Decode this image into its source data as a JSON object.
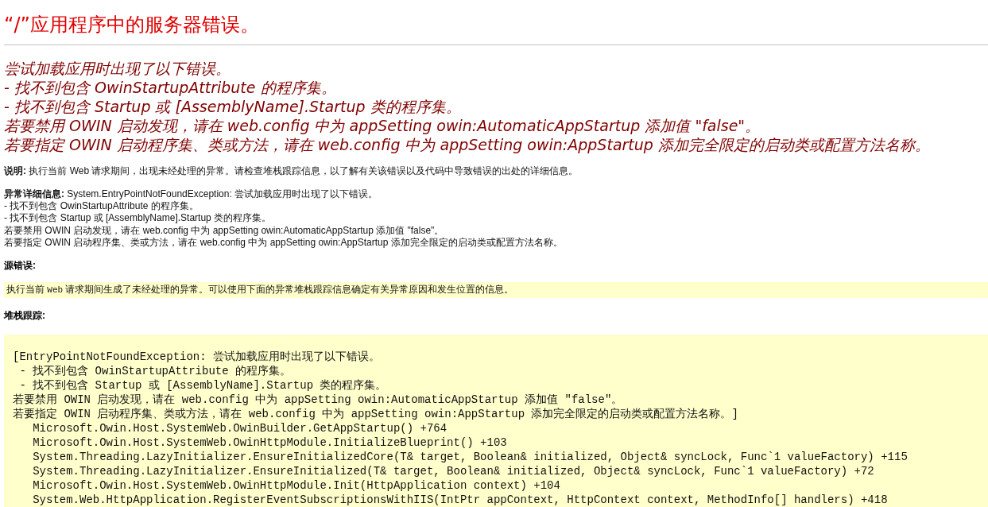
{
  "title": "“/”应用程序中的服务器错误。",
  "error_message": {
    "lines": [
      "尝试加载应用时出现了以下错误。",
      "- 找不到包含 OwinStartupAttribute 的程序集。",
      "- 找不到包含 Startup 或 [AssemblyName].Startup 类的程序集。",
      "若要禁用 OWIN 启动发现，请在 web.config 中为 appSetting owin:AutomaticAppStartup 添加值 \"false\"。",
      "若要指定 OWIN 启动程序集、类或方法，请在 web.config 中为 appSetting owin:AppStartup 添加完全限定的启动类或配置方法名称。"
    ]
  },
  "description": {
    "text": "**说明:** 执行当前 Web 请求期间，出现未经处理的异常。请检查堆栈跟踪信息，以了解有关该错误以及代码中导致错误的出处的详细信息。"
  },
  "exception_details": {
    "lines": [
      "**异常详细信息:** System.EntryPointNotFoundException: 尝试加载应用时出现了以下错误。",
      "- 找不到包含 OwinStartupAttribute 的程序集。",
      "- 找不到包含 Startup 或 [AssemblyName].Startup 类的程序集。",
      "若要禁用 OWIN 启动发现，请在 web.config 中为 appSetting owin:AutomaticAppStartup 添加值 \"false\"。",
      "若要指定 OWIN 启动程序集、类或方法，请在 web.config 中为 appSetting owin:AppStartup 添加完全限定的启动类或配置方法名称。"
    ]
  },
  "source_error": {
    "heading": "源错误:",
    "parts": [
      {
        "kind": "text",
        "text": "执行当前 "
      },
      {
        "kind": "code",
        "text": "Web"
      },
      {
        "kind": "text",
        "text": " 请求期间生成了未经处理的异常。可以使用下面的异常堆栈跟踪信息确定有关异常原因和发生位置的信息。"
      }
    ]
  },
  "stack_trace": {
    "heading": "堆栈跟踪:",
    "lines": [
      {
        "kind": "message",
        "text": "[EntryPointNotFoundException: 尝试加载应用时出现了以下错误。"
      },
      {
        "kind": "detail",
        "text": "- 找不到包含 OwinStartupAttribute 的程序集。"
      },
      {
        "kind": "detail",
        "text": "- 找不到包含 Startup 或 [AssemblyName].Startup 类的程序集。"
      },
      {
        "kind": "message",
        "text": "若要禁用 OWIN 启动发现，请在 web.config 中为 appSetting owin:AutomaticAppStartup 添加值 \"false\"。"
      },
      {
        "kind": "message",
        "text": "若要指定 OWIN 启动程序集、类或方法，请在 web.config 中为 appSetting owin:AppStartup 添加完全限定的启动类或配置方法名称。]"
      },
      {
        "kind": "frame",
        "text": "Microsoft.Owin.Host.SystemWeb.OwinBuilder.GetAppStartup() +764"
      },
      {
        "kind": "frame",
        "text": "Microsoft.Owin.Host.SystemWeb.OwinHttpModule.InitializeBlueprint() +103"
      },
      {
        "kind": "frame",
        "text": "System.Threading.LazyInitializer.EnsureInitializedCore(T& target, Boolean& initialized, Object& syncLock, Func`1 valueFactory) +115"
      },
      {
        "kind": "frame",
        "text": "System.Threading.LazyInitializer.EnsureInitialized(T& target, Boolean& initialized, Object& syncLock, Func`1 valueFactory) +72"
      },
      {
        "kind": "frame",
        "text": "Microsoft.Owin.Host.SystemWeb.OwinHttpModule.Init(HttpApplication context) +104"
      },
      {
        "kind": "frame",
        "text": "System.Web.HttpApplication.RegisterEventSubscriptionsWithIIS(IntPtr appContext, HttpContext context, MethodInfo[] handlers) +418"
      }
    ]
  }
}
